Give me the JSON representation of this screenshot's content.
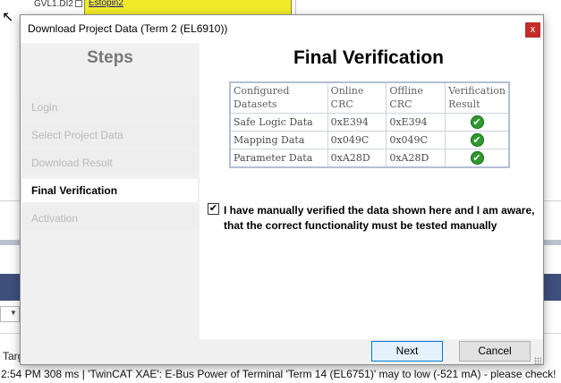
{
  "background": {
    "gvl_label": "GVL1.DI2",
    "estop_label": "Estopin2",
    "targ_label": "Targ",
    "log_line": "2:54 PM 308 ms | 'TwinCAT XAE': E-Bus Power of Terminal 'Term 14 (EL6751)' may to low (-521 mA) - please check!"
  },
  "dialog": {
    "title": "Download Project Data (Term 2 (EL6910))",
    "close_glyph": "x",
    "steps": {
      "heading": "Steps",
      "items": [
        {
          "label": "Login",
          "active": false
        },
        {
          "label": "Select Project Data",
          "active": false
        },
        {
          "label": "Download Result",
          "active": false
        },
        {
          "label": "Final Verification",
          "active": true
        },
        {
          "label": "Activation",
          "active": false
        }
      ]
    },
    "content": {
      "heading": "Final Verification",
      "table": {
        "headers": [
          {
            "line1": "Configured",
            "line2": "Datasets"
          },
          {
            "line1": "Online",
            "line2": "CRC"
          },
          {
            "line1": "Offline",
            "line2": "CRC"
          },
          {
            "line1": "Verification",
            "line2": "Result"
          }
        ],
        "rows": [
          {
            "dataset": "Safe Logic Data",
            "online": "0xE394",
            "offline": "0xE394",
            "result": "ok"
          },
          {
            "dataset": "Mapping Data",
            "online": "0x049C",
            "offline": "0x049C",
            "result": "ok"
          },
          {
            "dataset": "Parameter Data",
            "online": "0xA28D",
            "offline": "0xA28D",
            "result": "ok"
          }
        ]
      },
      "verify_checked": true,
      "verify_text": "I have manually verified the data shown here and I am aware, that the correct functionality must be tested manually"
    },
    "buttons": {
      "next": "Next",
      "cancel": "Cancel"
    }
  },
  "colors": {
    "close_button": "#c42b2b",
    "steps_panel": "#f0f0f0",
    "check_green": "#2f9a2f",
    "background_band": "#3e4f7c",
    "yellow_block": "#f1ea2a"
  }
}
